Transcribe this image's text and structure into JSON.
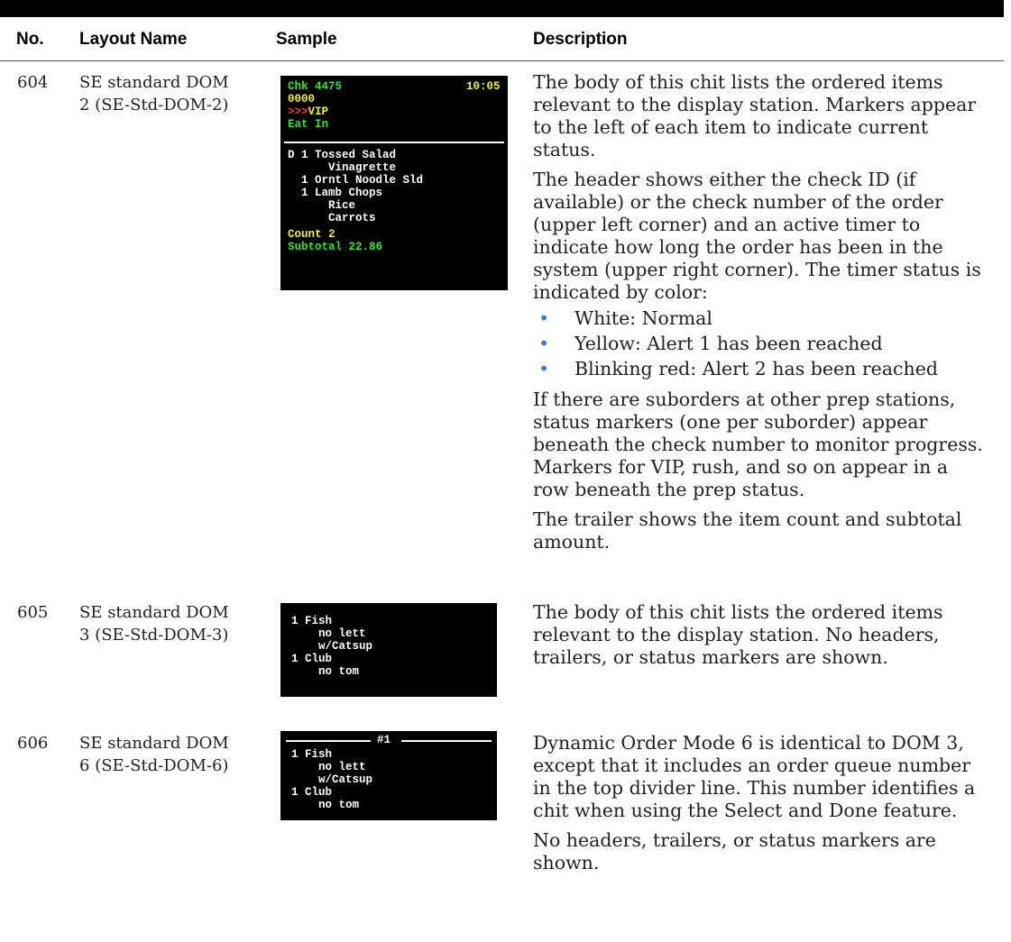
{
  "headers": {
    "no": "No.",
    "layout_name": "Layout Name",
    "sample": "Sample",
    "description": "Description"
  },
  "rows": [
    {
      "no": "604",
      "name_line1": "SE standard DOM",
      "name_line2": "2 (SE-Std-DOM-2)",
      "sample": {
        "chk": "Chk 4475",
        "time": "10:05",
        "code": "0000",
        "vip_arrows": ">>>",
        "vip": "VIP",
        "eat_in": "Eat In",
        "lines": [
          "D 1 Tossed Salad",
          "      Vinagrette",
          "  1 Orntl Noodle Sld",
          "  1 Lamb Chops",
          "      Rice",
          "      Carrots"
        ],
        "count": "Count 2",
        "subtotal": "Subtotal 22.86"
      },
      "desc_p1": "The body of this chit lists the ordered items relevant to the display station. Markers appear to the left of each item to indicate current status.",
      "desc_p2": "The header shows either the check ID (if available) or the check number of the order (upper left corner) and an active timer to indicate how long the order has been in the system (upper right corner). The timer status is indicated by color:",
      "bullets": [
        "White: Normal",
        "Yellow: Alert 1 has been reached",
        "Blinking red: Alert 2 has been reached"
      ],
      "desc_p3": "If there are suborders at other prep stations, status markers (one per suborder) appear beneath the check number to monitor progress. Markers for VIP, rush, and so on appear in a row beneath the prep status.",
      "desc_p4": "The trailer shows the item count and subtotal amount."
    },
    {
      "no": "605",
      "name_line1": "SE standard DOM",
      "name_line2": "3 (SE-Std-DOM-3)",
      "sample": {
        "lines": [
          "1 Fish",
          "    no lett",
          "    w/Catsup",
          "1 Club",
          "    no tom"
        ]
      },
      "desc_p1": "The body of this chit lists the ordered items relevant to the display station. No headers, trailers, or status markers are shown."
    },
    {
      "no": "606",
      "name_line1": "SE standard DOM",
      "name_line2": "6 (SE-Std-DOM-6)",
      "sample": {
        "queue": "#1",
        "lines": [
          "1 Fish",
          "    no lett",
          "    w/Catsup",
          "1 Club",
          "    no tom"
        ]
      },
      "desc_p1": "Dynamic Order Mode 6 is identical to DOM 3, except that it includes an order queue number in the top divider line. This number identifies a chit when using the Select and Done feature.",
      "desc_p2": "No headers, trailers, or status markers are shown."
    }
  ]
}
